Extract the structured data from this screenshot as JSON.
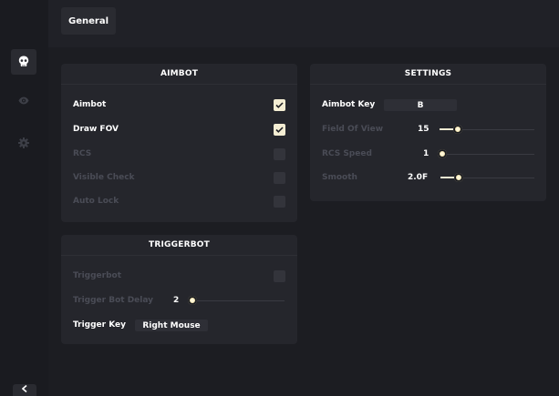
{
  "tabs": {
    "general": "General"
  },
  "sidebar": {
    "icons": [
      "skull-icon",
      "eye-icon",
      "gear-icon"
    ],
    "active": "skull-icon"
  },
  "aimbot": {
    "title": "AIMBOT",
    "rows": [
      {
        "label": "Aimbot",
        "enabled": true,
        "checked": true
      },
      {
        "label": "Draw FOV",
        "enabled": true,
        "checked": true
      },
      {
        "label": "RCS",
        "enabled": false,
        "checked": false
      },
      {
        "label": "Visible Check",
        "enabled": false,
        "checked": false
      },
      {
        "label": "Auto Lock",
        "enabled": false,
        "checked": false
      }
    ]
  },
  "triggerbot": {
    "title": "TRIGGERBOT",
    "enable_label": "Triggerbot",
    "delay_label": "Trigger Bot Delay",
    "delay_value": "2",
    "delay_fraction": 0.0,
    "key_label": "Trigger Key",
    "key_value": "Right Mouse"
  },
  "settings": {
    "title": "SETTINGS",
    "aimbot_key_label": "Aimbot Key",
    "aimbot_key_value": "B",
    "fov_label": "Field Of View",
    "fov_value": "15",
    "fov_fraction": 0.12,
    "rcs_speed_label": "RCS Speed",
    "rcs_speed_value": "1",
    "rcs_fraction": 0.0,
    "smooth_label": "Smooth",
    "smooth_value": "2.0F",
    "smooth_fraction": 0.12
  },
  "colors": {
    "background": "#1c1d22",
    "panel": "#25262c",
    "accent": "#f4edd3",
    "disabled_text": "#4a4c56"
  }
}
